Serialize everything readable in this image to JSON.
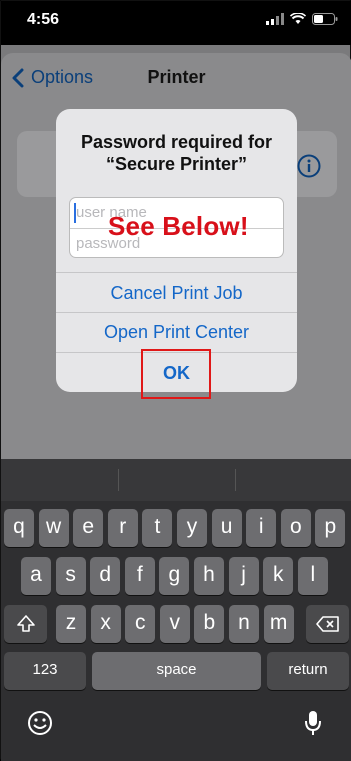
{
  "status": {
    "time": "4:56"
  },
  "nav": {
    "back_label": "Options",
    "title": "Printer"
  },
  "dialog": {
    "title_line1": "Password required for",
    "title_line2": "“Secure Printer”",
    "username_placeholder": "user name",
    "password_placeholder": "password",
    "actions": [
      "Cancel Print Job",
      "Open Print Center",
      "OK"
    ]
  },
  "annotation": {
    "text": "See Below!",
    "color": "#d8101a"
  },
  "keyboard": {
    "row1": [
      "q",
      "w",
      "e",
      "r",
      "t",
      "y",
      "u",
      "i",
      "o",
      "p"
    ],
    "row2": [
      "a",
      "s",
      "d",
      "f",
      "g",
      "h",
      "j",
      "k",
      "l"
    ],
    "row3": [
      "z",
      "x",
      "c",
      "v",
      "b",
      "n",
      "m"
    ],
    "numbers_key": "123",
    "space_key": "space",
    "return_key": "return"
  },
  "icons": [
    "battery-icon",
    "wifi-icon",
    "signal-icon",
    "chevron-left-icon",
    "info-icon",
    "shift-icon",
    "backspace-icon",
    "emoji-icon",
    "microphone-icon"
  ],
  "colors": {
    "accent": "#1467c8",
    "highlight": "#e01818"
  }
}
